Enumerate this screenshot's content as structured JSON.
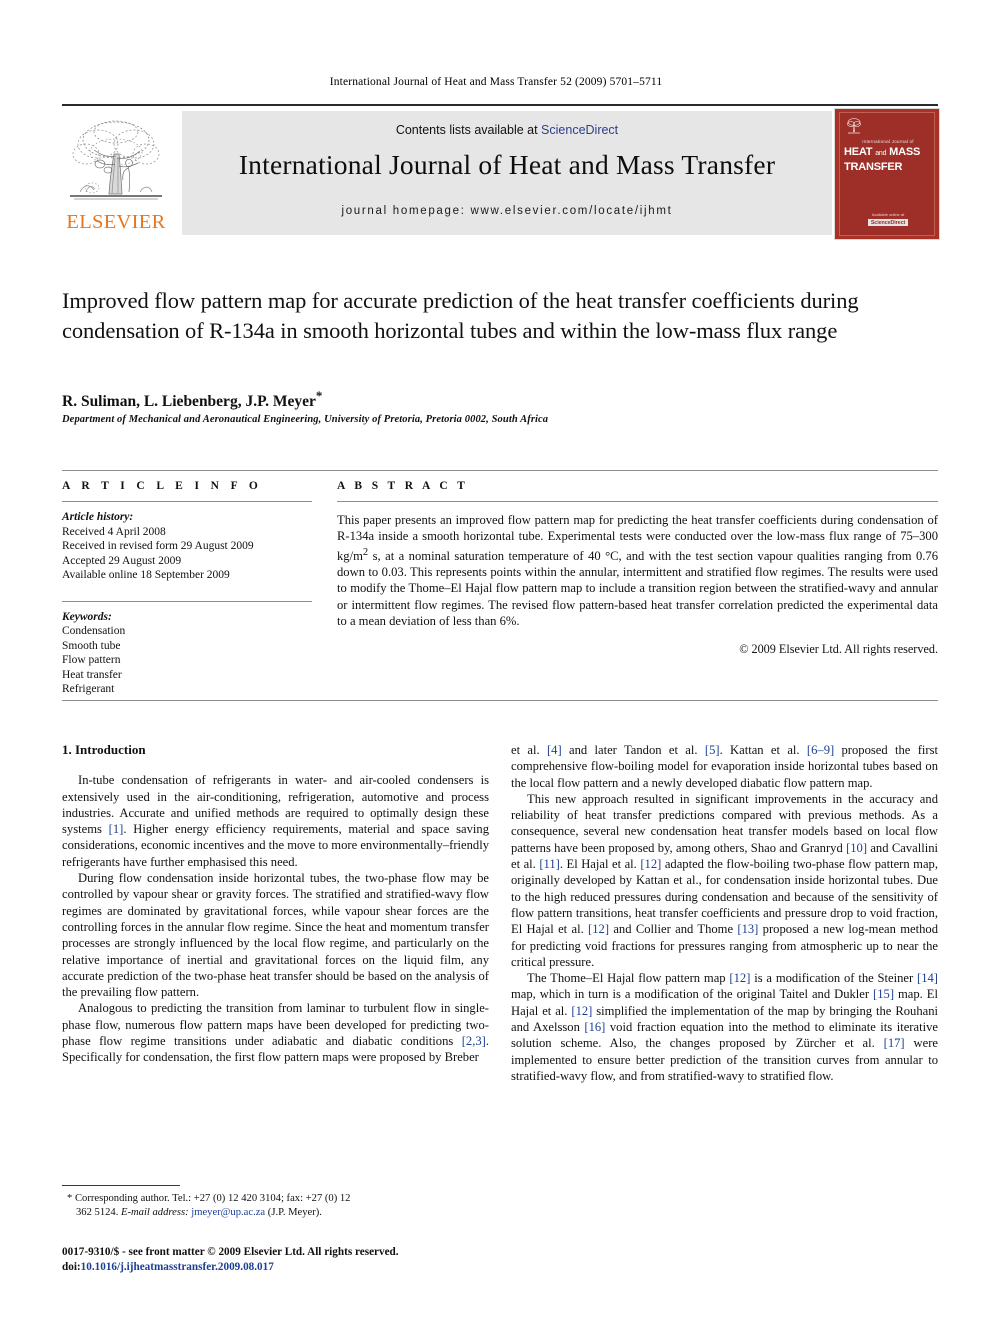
{
  "running_head": "International Journal of Heat and Mass Transfer 52 (2009) 5701–5711",
  "masthead": {
    "publisher_name": "ELSEVIER",
    "contents_prefix": "Contents lists available at ",
    "contents_link": "ScienceDirect",
    "journal_title": "International Journal of Heat and Mass Transfer",
    "homepage": "journal homepage: www.elsevier.com/locate/ijhmt",
    "cover": {
      "sub": "International Journal of",
      "line1": "HEAT",
      "and": "and",
      "line2": "MASS",
      "line3": "TRANSFER",
      "foot": "Available online at",
      "badge": "ScienceDirect"
    }
  },
  "article": {
    "title": "Improved flow pattern map for accurate prediction of the heat transfer coefficients during condensation of R-134a in smooth horizontal tubes and within the low-mass flux range",
    "authors": "R. Suliman, L. Liebenberg, J.P. Meyer",
    "corresponding_marker": "*",
    "affiliation": "Department of Mechanical and Aeronautical Engineering, University of Pretoria, Pretoria 0002, South Africa"
  },
  "info": {
    "heading": "A R T I C L E   I N F O",
    "history_label": "Article history:",
    "history": [
      "Received 4 April 2008",
      "Received in revised form 29 August 2009",
      "Accepted 29 August 2009",
      "Available online 18 September 2009"
    ],
    "keywords_label": "Keywords:",
    "keywords": [
      "Condensation",
      "Smooth tube",
      "Flow pattern",
      "Heat transfer",
      "Refrigerant"
    ]
  },
  "abstract": {
    "heading": "A B S T R A C T",
    "text_part1": "This paper presents an improved flow pattern map for predicting the heat transfer coefficients during condensation of R-134a inside a smooth horizontal tube. Experimental tests were conducted over the low-mass flux range of 75–300 kg/m",
    "superscript": "2",
    "text_part2": " s, at a nominal saturation temperature of 40 °C, and with the test section vapour qualities ranging from 0.76 down to 0.03. This represents points within the annular, intermittent and stratified flow regimes. The results were used to modify the Thome–El Hajal flow pattern map to include a transition region between the stratified-wavy and annular or intermittent flow regimes. The revised flow pattern-based heat transfer correlation predicted the experimental data to a mean deviation of less than 6%.",
    "copyright": "© 2009 Elsevier Ltd. All rights reserved."
  },
  "body": {
    "section_heading": "1. Introduction",
    "left": {
      "p1_a": "In-tube condensation of refrigerants in water- and air-cooled condensers is extensively used in the air-conditioning, refrigeration, automotive and process industries. Accurate and unified methods are required to optimally design these systems ",
      "p1_ref1": "[1]",
      "p1_b": ". Higher energy efficiency requirements, material and space saving considerations, economic incentives and the move to more environmentally–friendly refrigerants have further emphasised this need.",
      "p2": "During flow condensation inside horizontal tubes, the two-phase flow may be controlled by vapour shear or gravity forces. The stratified and stratified-wavy flow regimes are dominated by gravitational forces, while vapour shear forces are the controlling forces in the annular flow regime. Since the heat and momentum transfer processes are strongly influenced by the local flow regime, and particularly on the relative importance of inertial and gravitational forces on the liquid film, any accurate prediction of the two-phase heat transfer should be based on the analysis of the prevailing flow pattern.",
      "p3_a": "Analogous to predicting the transition from laminar to turbulent flow in single-phase flow, numerous flow pattern maps have been developed for predicting two-phase flow regime transitions under adiabatic and diabatic conditions ",
      "p3_ref": "[2,3]",
      "p3_b": ". Specifically for condensation, the first flow pattern maps were proposed by Breber"
    },
    "right": {
      "p1_a": "et al. ",
      "p1_ref1": "[4]",
      "p1_b": " and later Tandon et al. ",
      "p1_ref2": "[5]",
      "p1_c": ". Kattan et al. ",
      "p1_ref3": "[6–9]",
      "p1_d": " proposed the first comprehensive flow-boiling model for evaporation inside horizontal tubes based on the local flow pattern and a newly developed diabatic flow pattern map.",
      "p2_a": "This new approach resulted in significant improvements in the accuracy and reliability of heat transfer predictions compared with previous methods. As a consequence, several new condensation heat transfer models based on local flow patterns have been proposed by, among others, Shao and Granryd ",
      "p2_ref1": "[10]",
      "p2_b": " and Cavallini et al. ",
      "p2_ref2": "[11]",
      "p2_c": ". El Hajal et al. ",
      "p2_ref3": "[12]",
      "p2_d": " adapted the flow-boiling two-phase flow pattern map, originally developed by Kattan et al., for condensation inside horizontal tubes. Due to the high reduced pressures during condensation and because of the sensitivity of flow pattern transitions, heat transfer coefficients and pressure drop to void fraction, El Hajal et al. ",
      "p2_ref4": "[12]",
      "p2_e": " and Collier and Thome ",
      "p2_ref5": "[13]",
      "p2_f": " proposed a new log-mean method for predicting void fractions for pressures ranging from atmospheric up to near the critical pressure.",
      "p3_a": "The Thome–El Hajal flow pattern map ",
      "p3_ref1": "[12]",
      "p3_b": " is a modification of the Steiner ",
      "p3_ref2": "[14]",
      "p3_c": " map, which in turn is a modification of the original Taitel and Dukler ",
      "p3_ref3": "[15]",
      "p3_d": " map. El Hajal et al. ",
      "p3_ref4": "[12]",
      "p3_e": " simplified the implementation of the map by bringing the Rouhani and Axelsson ",
      "p3_ref5": "[16]",
      "p3_f": " void fraction equation into the method to eliminate its iterative solution scheme. Also, the changes proposed by Zürcher et al. ",
      "p3_ref6": "[17]",
      "p3_g": " were implemented to ensure better prediction of the transition curves from annular to stratified-wavy flow, and from stratified-wavy to stratified flow."
    }
  },
  "footnote": {
    "marker": "*",
    "text_a": "Corresponding author. Tel.: +27 (0) 12 420 3104; fax: +27 (0) 12 362 5124.",
    "email_label": "E-mail address:",
    "email": "jmeyer@up.ac.za",
    "email_suffix": "(J.P. Meyer)."
  },
  "page_footer": {
    "issn_line": "0017-9310/$ - see front matter © 2009 Elsevier Ltd. All rights reserved.",
    "doi_label": "doi:",
    "doi_value": "10.1016/j.ijheatmasstransfer.2009.08.017"
  },
  "colors": {
    "elsevier_orange": "#e8761b",
    "link_blue": "#1c3f94",
    "sciencedirect_blue": "#2b3f8c",
    "masthead_grey": "#e6e6e6",
    "cover_red": "#9d2f28"
  }
}
